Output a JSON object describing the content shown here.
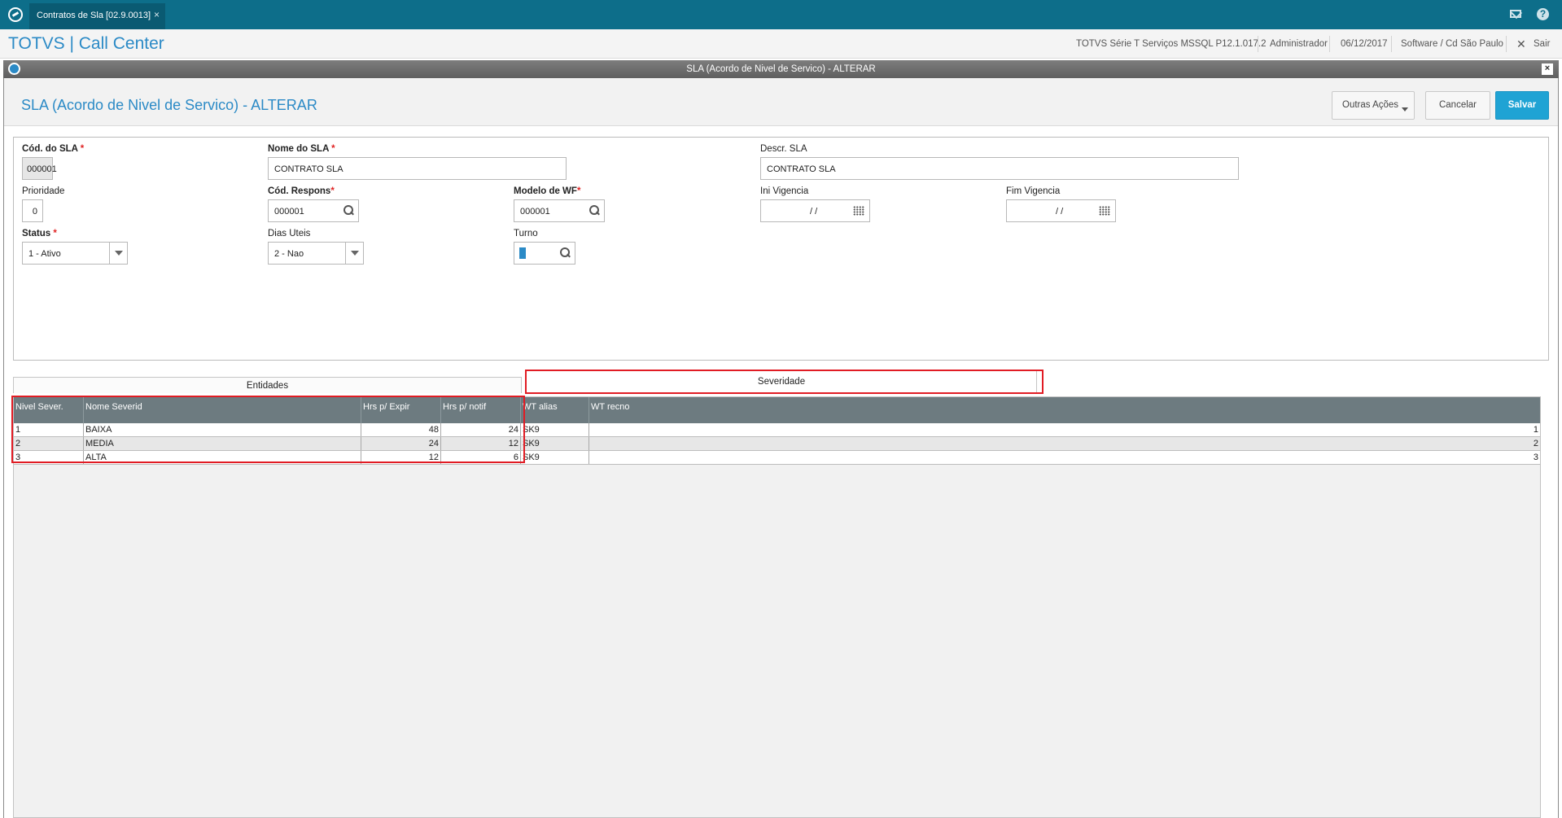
{
  "tab": {
    "label": "Contratos de Sla [02.9.0013]",
    "close": "×"
  },
  "header": {
    "brand": "TOTVS | Call Center",
    "system": "TOTVS Série T Serviços MSSQL P12.1.017.2",
    "user": "Administrador",
    "date": "06/12/2017",
    "company": "Software / Cd São Paulo",
    "exit": "Sair"
  },
  "window": {
    "title": "SLA (Acordo de Nivel de Servico) - ALTERAR",
    "close": "×"
  },
  "page": {
    "title": "SLA (Acordo de Nivel de Servico) - ALTERAR"
  },
  "actions": {
    "outras": "Outras Ações",
    "cancel": "Cancelar",
    "save": "Salvar"
  },
  "form": {
    "cod_sla": {
      "label": "Cód. do SLA",
      "value": "000001"
    },
    "nome_sla": {
      "label": "Nome do SLA",
      "value": "CONTRATO SLA"
    },
    "descr_sla": {
      "label": "Descr. SLA",
      "value": "CONTRATO SLA"
    },
    "prioridade": {
      "label": "Prioridade",
      "value": "0"
    },
    "cod_respons": {
      "label": "Cód. Respons",
      "value": "000001"
    },
    "modelo_wf": {
      "label": "Modelo de WF",
      "value": "000001"
    },
    "ini_vigencia": {
      "label": "Ini Vigencia",
      "value": "/ /"
    },
    "fim_vigencia": {
      "label": "Fim Vigencia",
      "value": "/ /"
    },
    "status": {
      "label": "Status",
      "value": "1 - Ativo"
    },
    "dias_uteis": {
      "label": "Dias Uteis",
      "value": "2 - Nao"
    },
    "turno": {
      "label": "Turno",
      "value": ""
    },
    "required_mark": "*"
  },
  "tabs": {
    "entidades": "Entidades",
    "severidade": "Severidade"
  },
  "grid": {
    "columns": [
      "Nivel Sever.",
      "Nome Severid",
      "Hrs p/ Expir",
      "Hrs p/ notif",
      "WT alias",
      "WT recno"
    ],
    "rows": [
      [
        "1",
        "BAIXA",
        "48",
        "24",
        "SK9",
        "1"
      ],
      [
        "2",
        "MEDIA",
        "24",
        "12",
        "SK9",
        "2"
      ],
      [
        "3",
        "ALTA",
        "12",
        "6",
        "SK9",
        "3"
      ]
    ]
  },
  "colors": {
    "topbar": "#0d6e8a",
    "brand": "#2b8ac6",
    "save": "#1fa3d4",
    "highlight": "#e11c24"
  },
  "icons": {
    "app": "app-logo-icon",
    "mail": "mail-icon",
    "help": "help-icon",
    "exit": "close-icon",
    "search": "search-icon",
    "calendar": "calendar-icon",
    "dropdown": "chevron-down-icon"
  }
}
